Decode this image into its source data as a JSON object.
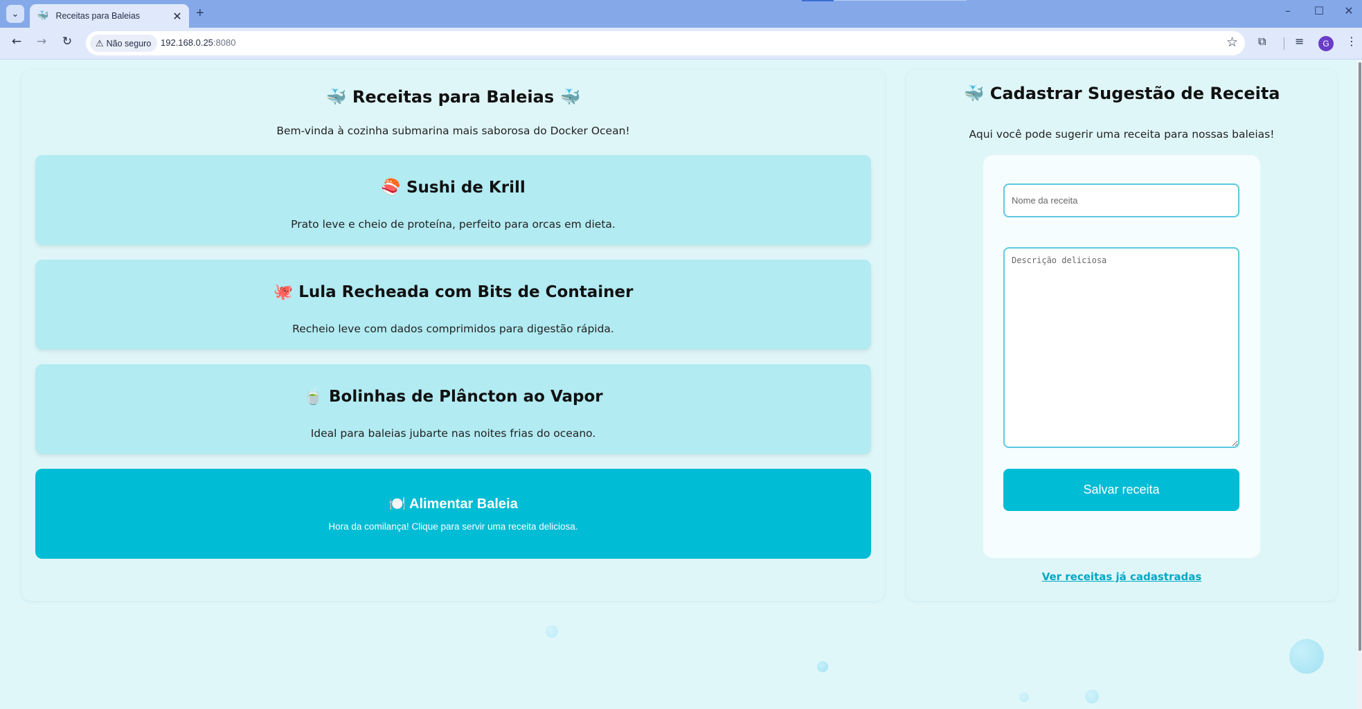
{
  "browser": {
    "tab_title": "Receitas para Baleias",
    "tab_favicon": "🐳",
    "new_tab_symbol": "+",
    "security_label": "Não seguro",
    "url_host": "192.168.0.25",
    "url_port": ":8080",
    "profile_initial": "G",
    "icons": [
      "tab-search-icon",
      "close-icon",
      "new-tab-icon",
      "minimize-icon",
      "maximize-icon",
      "window-close-icon",
      "back-icon",
      "forward-icon",
      "reload-icon",
      "warning-icon",
      "star-icon",
      "extensions-icon",
      "media-icon",
      "menu-icon"
    ]
  },
  "left": {
    "title_emoji_left": "🐳",
    "title": "Receitas para Baleias",
    "title_emoji_right": "🐳",
    "subtitle": "Bem-vinda à cozinha submarina mais saborosa do Docker Ocean!",
    "recipes": [
      {
        "emoji": "🍣",
        "title": "Sushi de Krill",
        "description": "Prato leve e cheio de proteína, perfeito para orcas em dieta."
      },
      {
        "emoji": "🐙",
        "title": "Lula Recheada com Bits de Container",
        "description": "Recheio leve com dados comprimidos para digestão rápida."
      },
      {
        "emoji": "🍵",
        "title": "Bolinhas de Plâncton ao Vapor",
        "description": "Ideal para baleias jubarte nas noites frias do oceano."
      }
    ],
    "feed_button": {
      "emoji": "🍽️",
      "title": "Alimentar Baleia",
      "description": "Hora da comilança! Clique para servir uma receita deliciosa."
    }
  },
  "right": {
    "title_emoji": "🐳",
    "title": "Cadastrar Sugestão de Receita",
    "subtitle": "Aqui você pode sugerir uma receita para nossas baleias!",
    "name_placeholder": "Nome da receita",
    "description_placeholder": "Descrição deliciosa",
    "save_label": "Salvar receita",
    "view_link": "Ver receitas já cadastradas"
  },
  "colors": {
    "accent": "#00bcd4",
    "card": "#b2ebf2",
    "panel": "#dff6f8",
    "background": "#e0f7fa",
    "tabbar": "#85a9e8"
  }
}
